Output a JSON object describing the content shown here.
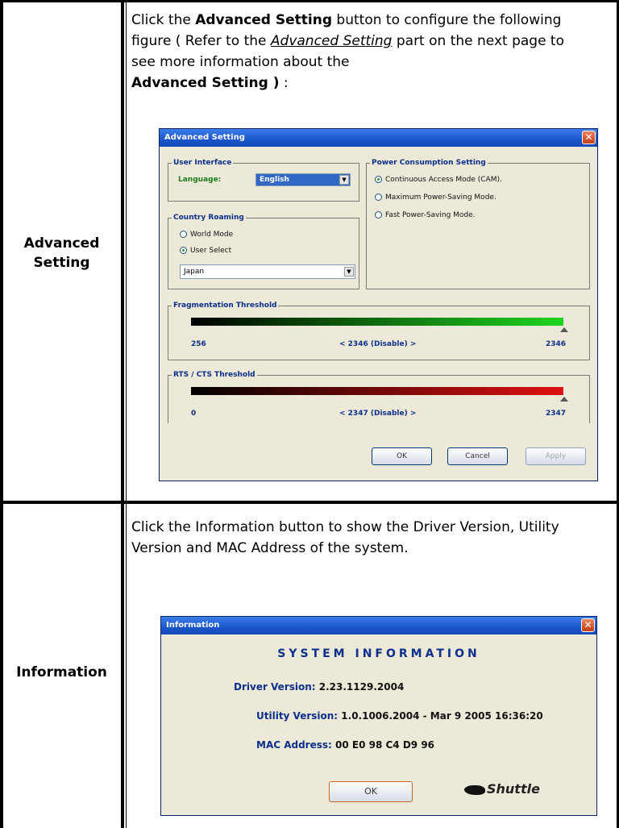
{
  "rows": [
    {
      "label_line1": "Advanced",
      "label_line2": "Setting",
      "desc": {
        "p1": "Click the ",
        "b1": "Advanced Setting",
        "p2": " button to configure the following figure ( Refer to the ",
        "link": "Advanced Setting",
        "p3": "  part on the next page to see more information about the ",
        "b2": "Advanced Setting )",
        "p4": " :"
      }
    },
    {
      "label": "Information",
      "desc": "Click the Information button to show the Driver Version, Utility Version and MAC Address of the system."
    }
  ],
  "advanced_window": {
    "title": "Advanced Setting",
    "user_interface": {
      "group_label": "User Interface",
      "language_label": "Language:",
      "language_value": "English"
    },
    "country_roaming": {
      "group_label": "Country Roaming",
      "options": [
        "World Mode",
        "User Select"
      ],
      "selected": "User Select",
      "country_value": "Japan"
    },
    "power": {
      "group_label": "Power Consumption Setting",
      "options": [
        "Continuous Access Mode (CAM).",
        "Maximum Power-Saving Mode.",
        "Fast Power-Saving Mode."
      ],
      "selected": "Continuous Access Mode (CAM)."
    },
    "fragmentation": {
      "group_label": "Fragmentation Threshold",
      "min": "256",
      "center": "< 2346 (Disable) >",
      "max": "2346",
      "level": 1.0
    },
    "rts": {
      "group_label": "RTS / CTS Threshold",
      "min": "0",
      "center": "< 2347 (Disable) >",
      "max": "2347",
      "level": 1.0
    },
    "buttons": {
      "ok": "OK",
      "cancel": "Cancel",
      "apply": "Apply"
    }
  },
  "info_window": {
    "title": "Information",
    "heading": "SYSTEM INFORMATION",
    "driver_label": "Driver Version:",
    "driver_value": "2.23.1129.2004",
    "utility_label": "Utility Version:",
    "utility_value": "1.0.1006.2004 - Mar  9 2005 16:36:20",
    "mac_label": "MAC Address:",
    "mac_value": "00 E0 98 C4 D9 96",
    "ok": "OK",
    "logo": "Shuttle"
  },
  "colors": {
    "titlebar": "#1a56c9",
    "group_label": "#0b2f8a",
    "frag_bar_end": "#1fd51f",
    "rts_bar_end": "#e01010"
  }
}
